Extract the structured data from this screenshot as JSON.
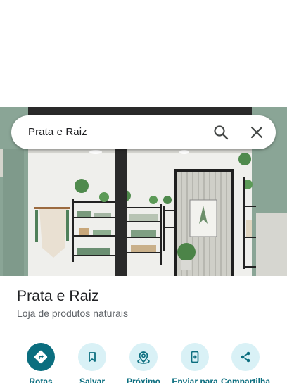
{
  "search": {
    "query": "Prata e Raiz"
  },
  "place": {
    "name": "Prata e Raiz",
    "category": "Loja de produtos naturais"
  },
  "actions": [
    {
      "label": "Rotas",
      "icon": "directions-icon"
    },
    {
      "label": "Salvar",
      "icon": "bookmark-icon"
    },
    {
      "label": "Próximo",
      "icon": "nearby-icon"
    },
    {
      "label": "Enviar para",
      "icon": "send-to-phone-icon"
    },
    {
      "label": "Compartilha",
      "icon": "share-icon"
    }
  ],
  "colors": {
    "accent": "#0b6e7f",
    "action_bg": "#d9f1f6",
    "title": "#202124",
    "subtitle": "#5f6368"
  }
}
